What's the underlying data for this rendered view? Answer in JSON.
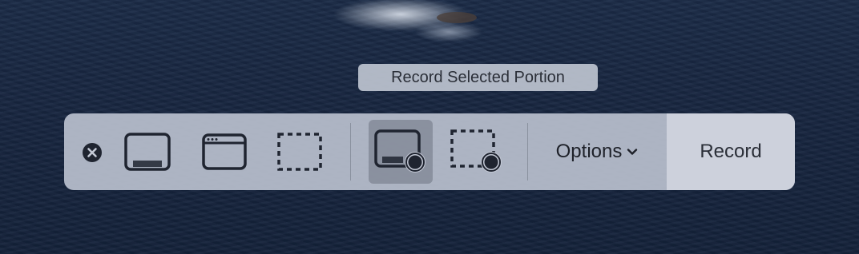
{
  "tooltip": {
    "text": "Record Selected Portion"
  },
  "toolbar": {
    "close_icon": "close-circle-icon",
    "buttons": [
      {
        "icon": "capture-entire-screen-icon",
        "selected": false
      },
      {
        "icon": "capture-selected-window-icon",
        "selected": false
      },
      {
        "icon": "capture-selected-portion-icon",
        "selected": false
      },
      {
        "icon": "record-entire-screen-icon",
        "selected": true
      },
      {
        "icon": "record-selected-portion-icon",
        "selected": false
      }
    ],
    "options_label": "Options",
    "options_chevron_icon": "chevron-down-icon",
    "record_label": "Record"
  },
  "colors": {
    "icon": "#1f2430",
    "toolbar_bg": "#bac0ce",
    "selected_bg": "#7a8090",
    "tooltip_bg": "#bec4d0"
  }
}
